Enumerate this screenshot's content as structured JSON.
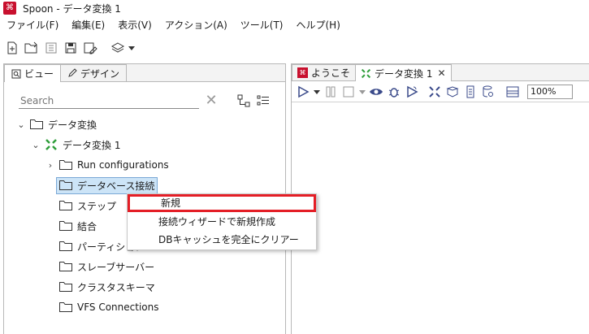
{
  "window": {
    "app_icon_glyph": "⌘",
    "title": "Spoon - データ変換 1"
  },
  "menubar": {
    "items": [
      {
        "label": "ファイル(F)"
      },
      {
        "label": "編集(E)"
      },
      {
        "label": "表示(V)"
      },
      {
        "label": "アクション(A)"
      },
      {
        "label": "ツール(T)"
      },
      {
        "label": "ヘルプ(H)"
      }
    ]
  },
  "left_panel": {
    "tabs": [
      {
        "label": "ビュー",
        "icon": "view-icon",
        "active": true
      },
      {
        "label": "デザイン",
        "icon": "pencil-icon",
        "active": false
      }
    ],
    "search": {
      "value": "",
      "placeholder": "Search"
    },
    "tree": {
      "root": "データ変換",
      "transformation": "データ変換 1",
      "children": [
        "Run configurations",
        "データベース接続",
        "ステップ",
        "結合",
        "パーティション",
        "スレーブサーバー",
        "クラスタスキーマ",
        "VFS Connections"
      ],
      "selected": "データベース接続"
    }
  },
  "right_panel": {
    "tabs": [
      {
        "label": "ようこそ",
        "icon": "spoon-icon",
        "active": false
      },
      {
        "label": "データ変換 1",
        "icon": "transformation-icon",
        "active": true
      }
    ],
    "zoom": "100%"
  },
  "context_menu": {
    "items": [
      {
        "label": "新規",
        "highlighted": true
      },
      {
        "label": "接続ウィザードで新規作成",
        "highlighted": false
      },
      {
        "label": "DBキャッシュを完全にクリアー",
        "highlighted": false
      }
    ]
  },
  "colors": {
    "accent": "#e41e26",
    "selection": "#cce4f7",
    "transform_green": "#2e9e3a"
  }
}
